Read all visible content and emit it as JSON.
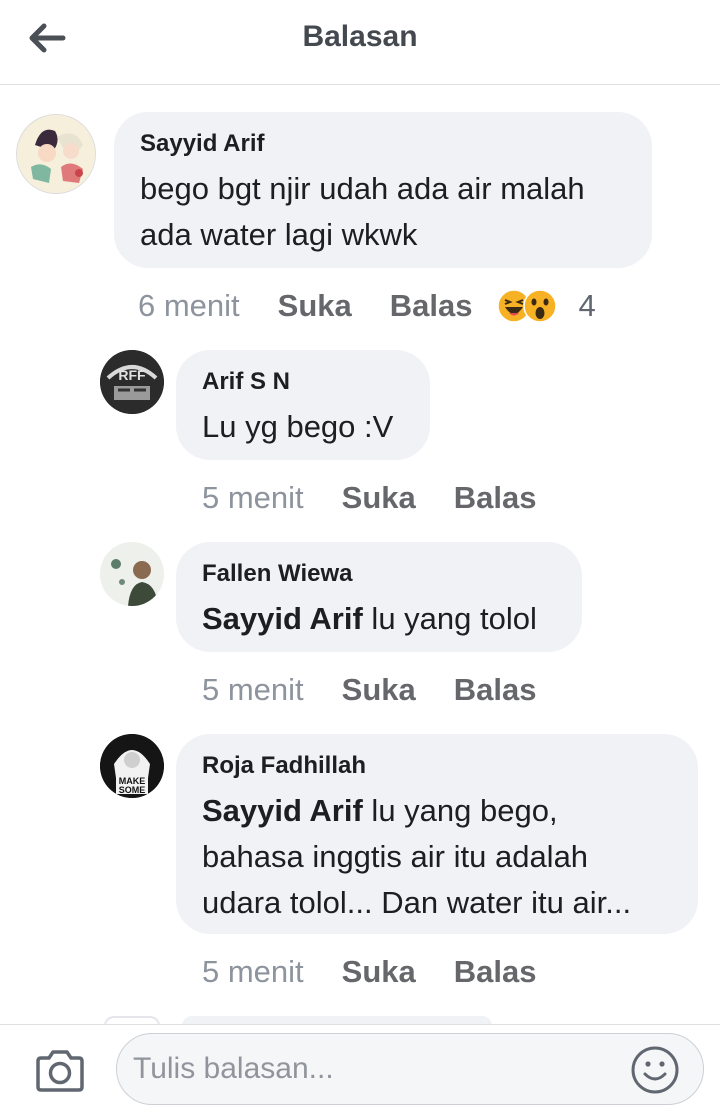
{
  "header": {
    "title": "Balasan"
  },
  "comments": [
    {
      "author": "Sayyid Arif",
      "line1": "bego bgt njir udah ada air malah",
      "line2": "ada water lagi wkwk",
      "time": "6 menit",
      "like_label": "Suka",
      "reply_label": "Balas",
      "reaction_count": "4",
      "reaction_icons": [
        "haha-icon",
        "wow-icon"
      ]
    },
    {
      "author": "Arif S N",
      "text": "Lu yg bego :V",
      "time": "5 menit",
      "like_label": "Suka",
      "reply_label": "Balas"
    },
    {
      "author": "Fallen Wiewa",
      "mention": "Sayyid Arif",
      "text": " lu yang tolol",
      "time": "5 menit",
      "like_label": "Suka",
      "reply_label": "Balas"
    },
    {
      "author": "Roja Fadhillah",
      "mention": "Sayyid Arif",
      "line1": " lu yang bego,",
      "line2": "bahasa inggtis air itu adalah",
      "line3": "udara tolol... Dan water itu air...",
      "time": "5 menit",
      "like_label": "Suka",
      "reply_label": "Balas",
      "avatar_text": [
        "MAKE",
        "SOME"
      ]
    }
  ],
  "footer": {
    "placeholder": "Tulis balasan..."
  },
  "colors": {
    "bubble": "#f0f2f5",
    "action": "#65676b",
    "time": "#8d949e",
    "haha": "#f7b125",
    "wow": "#f7b125"
  }
}
